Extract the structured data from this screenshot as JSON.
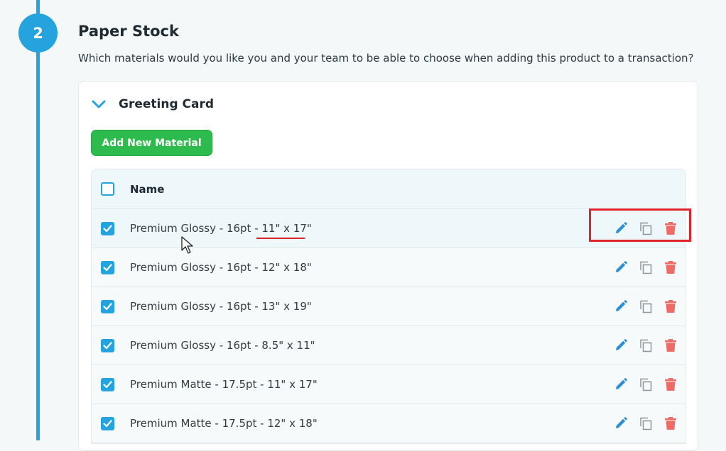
{
  "step": {
    "number": "2",
    "title": "Paper Stock",
    "description": "Which materials would you like you and your team to be able to choose when adding this product to a transaction?"
  },
  "card": {
    "title": "Greeting Card",
    "add_button_label": "Add New Material"
  },
  "table": {
    "column_name": "Name",
    "rows": [
      {
        "name": "Premium Glossy - 16pt - 11\" x 17\"",
        "checked": true
      },
      {
        "name": "Premium Glossy - 16pt - 12\" x 18\"",
        "checked": true
      },
      {
        "name": "Premium Glossy - 16pt - 13\" x 19\"",
        "checked": true
      },
      {
        "name": "Premium Glossy - 16pt - 8.5\" x 11\"",
        "checked": true
      },
      {
        "name": "Premium Matte - 17.5pt - 11\" x 17\"",
        "checked": true
      },
      {
        "name": "Premium Matte - 17.5pt - 12\" x 18\"",
        "checked": true
      }
    ]
  },
  "icons": {
    "edit": "pencil-icon",
    "duplicate": "copy-icon",
    "delete": "trash-icon"
  },
  "colors": {
    "accent": "#24a3df",
    "add_button": "#2dbb4e",
    "delete_icon": "#ee6b66",
    "annotation": "#e0232b"
  }
}
